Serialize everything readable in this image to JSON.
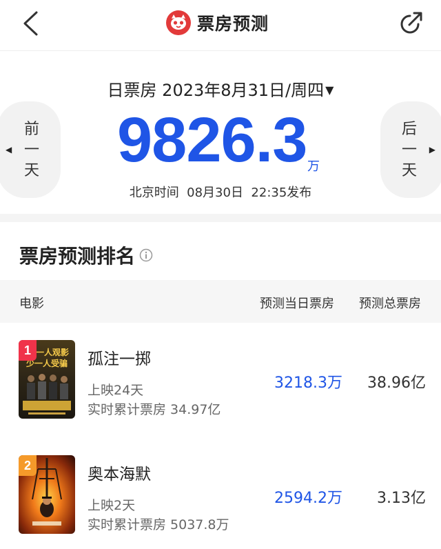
{
  "header": {
    "title": "票房预测",
    "back_icon": "chevron-left-icon",
    "share_icon": "share-icon",
    "brand_color": "#e23a3a"
  },
  "summary": {
    "date_label": "日票房",
    "date": "2023年8月31日/周四",
    "prev_day": [
      "前",
      "一",
      "天"
    ],
    "next_day": [
      "后",
      "一",
      "天"
    ],
    "total_value": "9826.3",
    "total_unit": "万",
    "release_prefix": "北京时间",
    "release_date": "08月30日",
    "release_time": "22:35发布",
    "accent_color": "#1f55e6"
  },
  "ranking": {
    "title": "票房预测排名",
    "columns": [
      "电影",
      "预测当日票房",
      "预测总票房"
    ],
    "movies": [
      {
        "rank": "1",
        "title": "孤注一掷",
        "poster_text_1": "一人观影",
        "poster_text_2": "少一人受骗",
        "days": "上映24天",
        "cumulative": "实时累计票房 34.97亿",
        "day_pred": "3218.3万",
        "total_pred": "38.96亿"
      },
      {
        "rank": "2",
        "title": "奥本海默",
        "days": "上映2天",
        "cumulative": "实时累计票房 5037.8万",
        "day_pred": "2594.2万",
        "total_pred": "3.13亿"
      }
    ]
  }
}
